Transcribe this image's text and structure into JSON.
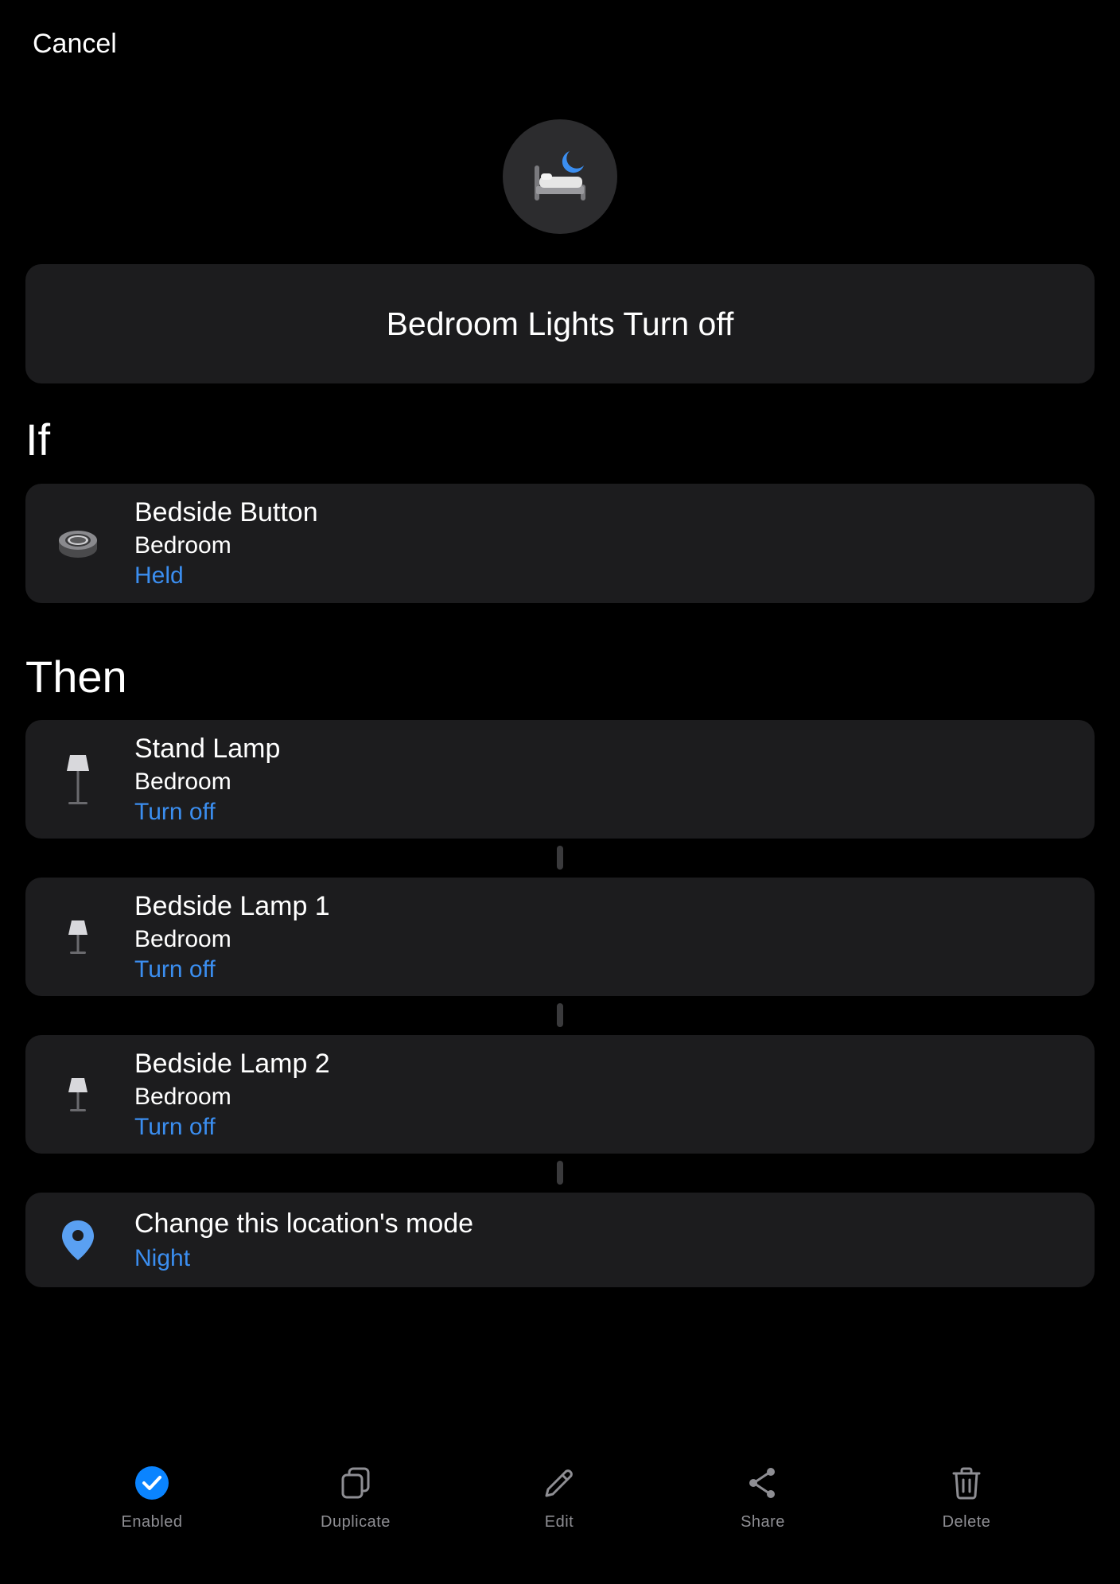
{
  "header": {
    "cancel_label": "Cancel"
  },
  "routine": {
    "name": "Bedroom Lights Turn off"
  },
  "sections": {
    "if_title": "If",
    "then_title": "Then"
  },
  "trigger": {
    "title": "Bedside Button",
    "room": "Bedroom",
    "state": "Held"
  },
  "actions": [
    {
      "title": "Stand Lamp",
      "room": "Bedroom",
      "command": "Turn off"
    },
    {
      "title": "Bedside Lamp 1",
      "room": "Bedroom",
      "command": "Turn off"
    },
    {
      "title": "Bedside Lamp 2",
      "room": "Bedroom",
      "command": "Turn off"
    }
  ],
  "mode_action": {
    "title": "Change this location's mode",
    "value": "Night"
  },
  "toolbar": {
    "enabled_label": "Enabled",
    "duplicate_label": "Duplicate",
    "edit_label": "Edit",
    "share_label": "Share",
    "delete_label": "Delete"
  },
  "colors": {
    "accent": "#3b8ef0",
    "card": "#1c1c1e",
    "background": "#000000",
    "enabled": "#0a84ff"
  },
  "icons": [
    "bed-moon-icon",
    "button-device-icon",
    "lamp-icon",
    "location-pin-icon",
    "check-circle-icon",
    "duplicate-icon",
    "pencil-icon",
    "share-icon",
    "trash-icon"
  ]
}
